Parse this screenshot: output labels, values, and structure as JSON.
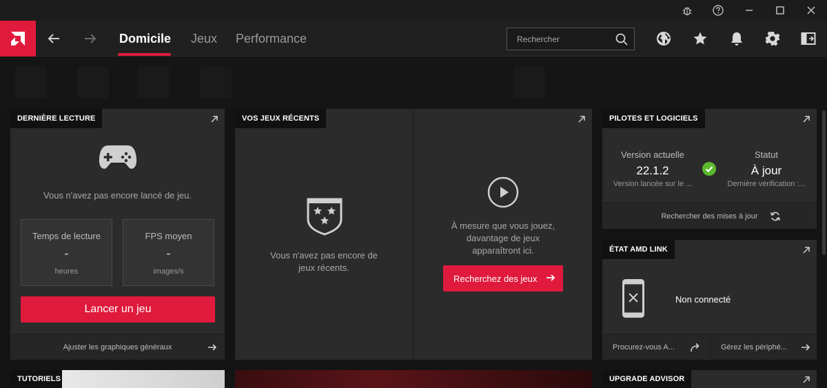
{
  "colors": {
    "accent": "#e01a3c",
    "status_ok": "#5cb82e"
  },
  "window_controls": [
    "bug-icon",
    "help-icon",
    "minimize-icon",
    "maximize-icon",
    "close-icon"
  ],
  "nav": {
    "tabs": [
      {
        "label": "Domicile",
        "active": true
      },
      {
        "label": "Jeux",
        "active": false
      },
      {
        "label": "Performance",
        "active": false
      }
    ]
  },
  "search": {
    "placeholder": "Rechercher",
    "value": ""
  },
  "header_icons": [
    "globe-icon",
    "star-icon",
    "bell-icon",
    "gear-icon",
    "sidebar-toggle-icon"
  ],
  "last_played": {
    "title": "DERNIÈRE LECTURE",
    "empty_message": "Vous n'avez pas encore lancé de jeu.",
    "stats": [
      {
        "label": "Temps de lecture",
        "value": "-",
        "unit": "heures"
      },
      {
        "label": "FPS moyen",
        "value": "-",
        "unit": "images/s"
      }
    ],
    "launch_button": "Lancer un jeu",
    "footer_link": "Ajuster les graphiques généraux"
  },
  "recent_games": {
    "title": "VOS JEUX RÉCENTS",
    "empty_message_line1": "Vous n'avez pas encore de",
    "empty_message_line2": "jeux récents.",
    "hint_line1": "À mesure que vous jouez,",
    "hint_line2": "davantage de jeux",
    "hint_line3": "apparaîtront ici.",
    "search_button": "Recherchez des jeux"
  },
  "drivers": {
    "title": "PILOTES ET LOGICIELS",
    "current_version_label": "Version actuelle",
    "current_version": "22.1.2",
    "version_sub": "Version lancée sur le ...",
    "status_label": "Statut",
    "status_value": "À jour",
    "status_sub": "Dernière vérification :...",
    "check_updates": "Rechercher des mises à jour"
  },
  "amd_link": {
    "title": "ÉTAT AMD LINK",
    "status": "Non connecté",
    "link_get": "Procurez-vous A...",
    "link_manage": "Gérez les périphé..."
  },
  "bottom": {
    "tutorials_title": "TUTORIELS",
    "upgrade_title": "UPGRADE ADVISOR"
  }
}
